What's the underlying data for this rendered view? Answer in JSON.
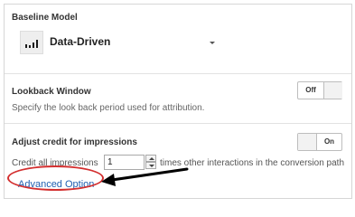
{
  "baseline": {
    "title": "Baseline Model",
    "selected_model": "Data-Driven",
    "model_icon": "bar-chart-icon",
    "dropdown_icon": "caret-down-icon"
  },
  "lookback": {
    "title": "Lookback Window",
    "description": "Specify the look back period used for attribution.",
    "toggle_label": "Off",
    "toggle_state": "off"
  },
  "impressions": {
    "title": "Adjust credit for impressions",
    "toggle_label": "On",
    "toggle_state": "on",
    "credit_prefix": "Credit all impressions",
    "credit_value": "1",
    "credit_suffix": "times other interactions in the conversion path"
  },
  "advanced": {
    "link_label": "Advanced Option"
  },
  "colors": {
    "link": "#1f5fb0",
    "annotation_ellipse": "#d32f2f",
    "annotation_arrow": "#000000"
  }
}
